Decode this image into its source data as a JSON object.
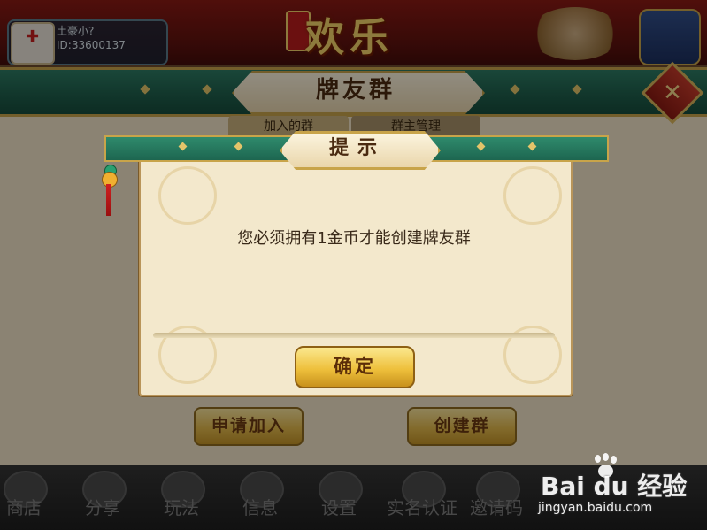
{
  "lobby": {
    "user": {
      "name": "土豪小?",
      "id": "ID:33600137"
    },
    "logo_text": "欢乐"
  },
  "panel": {
    "title": "牌友群",
    "close_glyph": "✕",
    "tabs": [
      {
        "label": "加入的群"
      },
      {
        "label": "群主管理"
      }
    ],
    "buttons": {
      "apply": "申请加入",
      "create": "创建群"
    }
  },
  "bottom_nav": [
    {
      "label": "商店",
      "icon": "cart-icon"
    },
    {
      "label": "分享",
      "icon": "share-icon"
    },
    {
      "label": "玩法",
      "icon": "question-icon"
    },
    {
      "label": "信息",
      "icon": "mail-icon"
    },
    {
      "label": "设置",
      "icon": "gear-icon"
    },
    {
      "label": "实名认证",
      "icon": "id-card-icon"
    },
    {
      "label": "邀请码",
      "icon": "ticket-icon"
    }
  ],
  "modal": {
    "title": "提示",
    "message": "您必须拥有1金币才能创建牌友群",
    "confirm_label": "确定"
  },
  "watermark": {
    "logo": "Bai du 经验",
    "url": "jingyan.baidu.com"
  },
  "colors": {
    "header_green": "#1e5d4a",
    "gold": "#c6a24b",
    "parchment": "#f3e8cc"
  }
}
